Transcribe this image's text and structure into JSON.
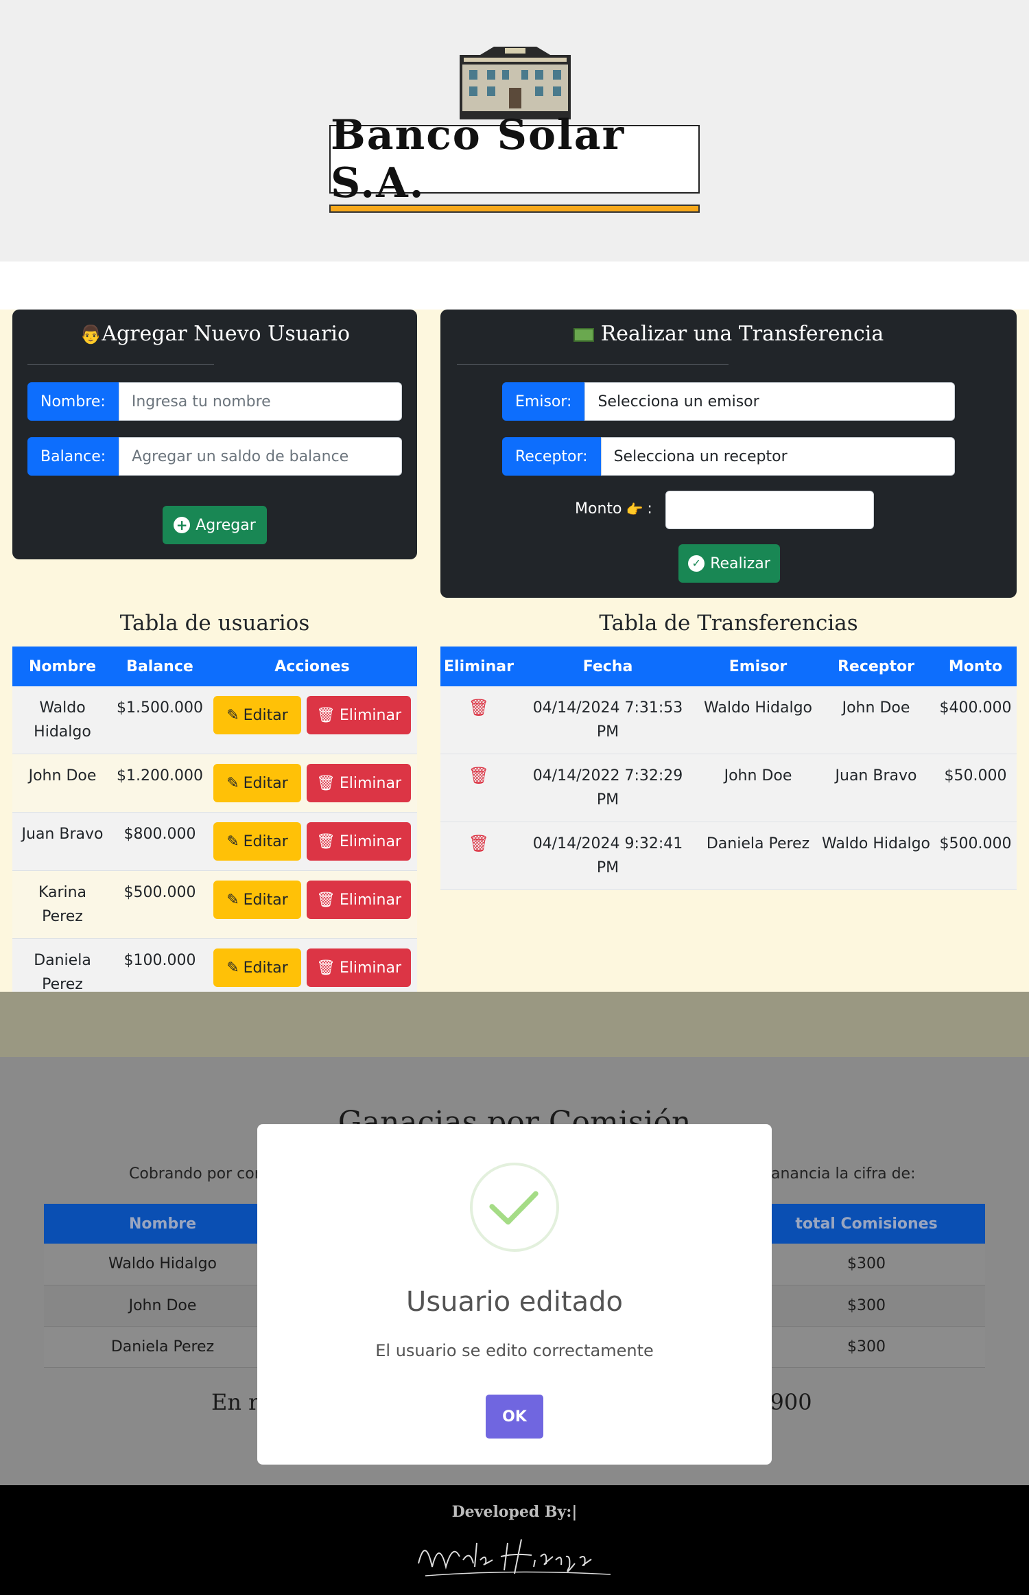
{
  "header": {
    "title": "Banco Solar S.A."
  },
  "new_user": {
    "title": "Agregar Nuevo Usuario",
    "name_label": "Nombre:",
    "name_placeholder": "Ingresa tu nombre",
    "balance_label": "Balance:",
    "balance_placeholder": "Agregar un saldo de balance",
    "add_button": "Agregar"
  },
  "transfer": {
    "title": "Realizar una Transferencia",
    "sender_label": "Emisor:",
    "sender_value": "Selecciona un emisor",
    "receiver_label": "Receptor:",
    "receiver_value": "Selecciona un receptor",
    "amount_label": "Monto",
    "amount_suffix": ":",
    "amount_value": "",
    "submit_button": "Realizar"
  },
  "users_table": {
    "title": "Tabla de usuarios",
    "headers": [
      "Nombre",
      "Balance",
      "Acciones"
    ],
    "edit_label": "Editar",
    "delete_label": "Eliminar",
    "rows": [
      {
        "name": "Waldo Hidalgo",
        "balance": "$1.500.000"
      },
      {
        "name": "John Doe",
        "balance": "$1.200.000"
      },
      {
        "name": "Juan Bravo",
        "balance": "$800.000"
      },
      {
        "name": "Karina Perez",
        "balance": "$500.000"
      },
      {
        "name": "Daniela Perez",
        "balance": "$100.000"
      }
    ]
  },
  "transfers_table": {
    "title": "Tabla de Transferencias",
    "headers": [
      "Eliminar",
      "Fecha",
      "Emisor",
      "Receptor",
      "Monto"
    ],
    "rows": [
      {
        "date": "04/14/2024 7:31:53 PM",
        "sender": "Waldo Hidalgo",
        "receiver": "John Doe",
        "amount": "$400.000"
      },
      {
        "date": "04/14/2022 7:32:29 PM",
        "sender": "John Doe",
        "receiver": "Juan Bravo",
        "amount": "$50.000"
      },
      {
        "date": "04/14/2024 9:32:41 PM",
        "sender": "Daniela Perez",
        "receiver": "Waldo Hidalgo",
        "amount": "$500.000"
      }
    ]
  },
  "commissions": {
    "title": "Ganacias por Comisión",
    "text_left": "Cobrando por con",
    "text_right": "anancia la cifra de:",
    "headers": [
      "Nombre",
      "total Comisiones"
    ],
    "rows": [
      {
        "name": "Waldo Hidalgo",
        "total": "$300"
      },
      {
        "name": "John Doe",
        "total": "$300"
      },
      {
        "name": "Daniela Perez",
        "total": "$300"
      }
    ],
    "total_left": "En re",
    "total_right": "$ 900"
  },
  "footer": {
    "developed_by": "Developed By:|",
    "signature": "Waldo Hidalgo"
  },
  "modal": {
    "title": "Usuario editado",
    "text": "El usuario se edito correctamente",
    "ok_label": "OK"
  },
  "colors": {
    "primary": "#0d6efd",
    "success": "#198754",
    "warning": "#ffc107",
    "danger": "#dc3545",
    "modal_ok": "#7066e0"
  }
}
